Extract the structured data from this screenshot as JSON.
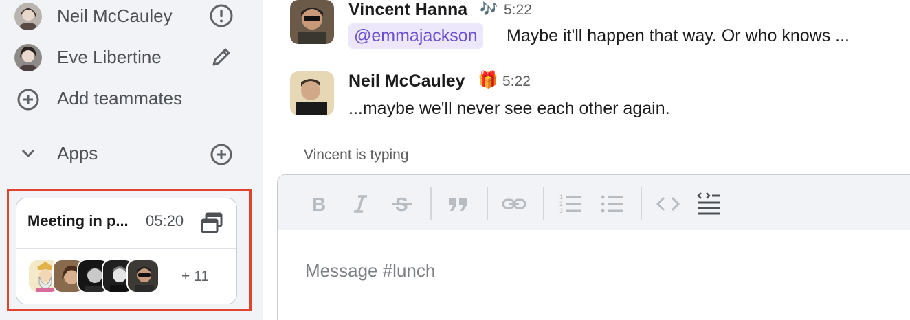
{
  "sidebar": {
    "members": [
      {
        "name": "Neil McCauley",
        "trailing_icon": "alert-circle-icon"
      },
      {
        "name": "Eve Libertine",
        "trailing_icon": "pencil-icon"
      }
    ],
    "add_teammates_label": "Add teammates",
    "apps_section_label": "Apps",
    "meeting_card": {
      "title": "Meeting in p...",
      "time": "05:20",
      "more_participants": "+ 11"
    }
  },
  "messages": [
    {
      "author": "Vincent Hanna",
      "status_emoji": "🎶",
      "time": "5:22",
      "mention": "@emmajackson",
      "text": "Maybe it'll happen that way. Or who knows ..."
    },
    {
      "author": "Neil McCauley",
      "status_emoji": "🎁",
      "time": "5:22",
      "text": "...maybe we'll never see each other again."
    }
  ],
  "typing_indicator": "Vincent is typing",
  "composer": {
    "placeholder": "Message #lunch",
    "toolbar_icons": [
      "bold-icon",
      "italic-icon",
      "strikethrough-icon",
      "quote-icon",
      "link-icon",
      "numbered-list-icon",
      "bullet-list-icon",
      "code-icon",
      "code-block-icon"
    ]
  },
  "colors": {
    "sidebar_bg": "#f1f3f6",
    "highlight_border": "#e0432f",
    "mention_text": "#6b4fcf",
    "mention_bg": "#ece7fb"
  }
}
